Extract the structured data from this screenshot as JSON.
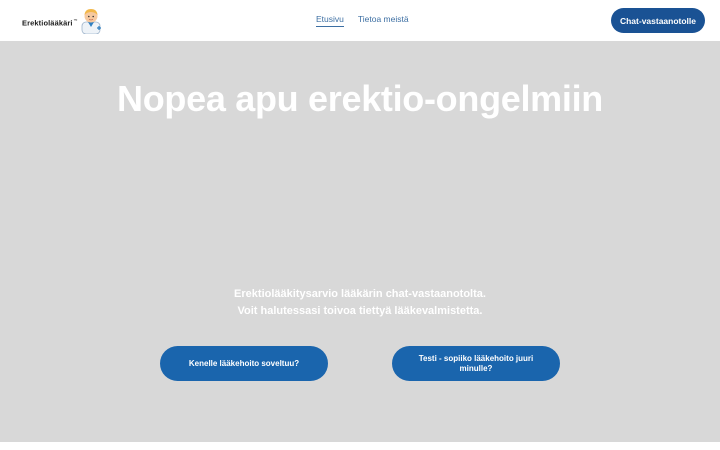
{
  "header": {
    "logo_text": "Erektiolääkäri",
    "logo_tm": "™",
    "nav": [
      {
        "label": "Etusivu",
        "active": true
      },
      {
        "label": "Tietoa meistä",
        "active": false
      }
    ],
    "cta_label": "Chat-vastaanotolle"
  },
  "hero": {
    "title": "Nopea apu erektio-ongelmiin",
    "subtitle_line1": "Erektiolääkitysarvio lääkärin chat-vastaanotolta.",
    "subtitle_line2": "Voit halutessasi toivoa tiettyä lääkevalmistetta.",
    "button_left": "Kenelle lääkehoito soveltuu?",
    "button_right": "Testi - sopiiko lääkehoito juuri minulle?"
  },
  "colors": {
    "accent": "#1a5294",
    "button": "#1a65ad",
    "hero_bg": "#d8d8d8",
    "nav_link": "#3d6fa3"
  }
}
